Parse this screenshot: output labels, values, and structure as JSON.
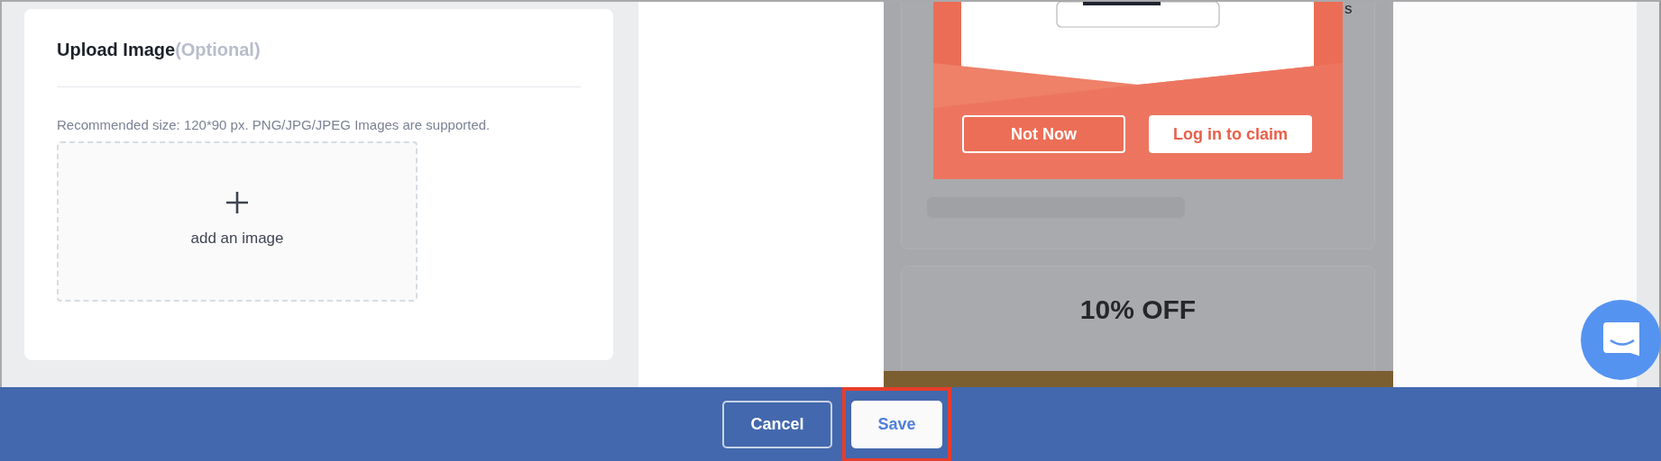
{
  "settings_card": {
    "title": "Upload Image",
    "title_note": "(Optional)",
    "hint": "Recommended size: 120*90 px. PNG/JPG/JPEG Images are supported.",
    "upload": {
      "label": "add an image"
    }
  },
  "preview": {
    "heading_fragments": [
      "s"
    ],
    "popup": {
      "buttons": [
        {
          "label": "Not Now",
          "kind": "outline"
        },
        {
          "label": "Log in to claim",
          "kind": "filled"
        }
      ]
    },
    "offer": {
      "title": "10% OFF"
    }
  },
  "footer": {
    "buttons": [
      {
        "label": "Cancel",
        "kind": "outline",
        "highlighted": false
      },
      {
        "label": "Save",
        "kind": "filled",
        "highlighted": true
      }
    ]
  }
}
